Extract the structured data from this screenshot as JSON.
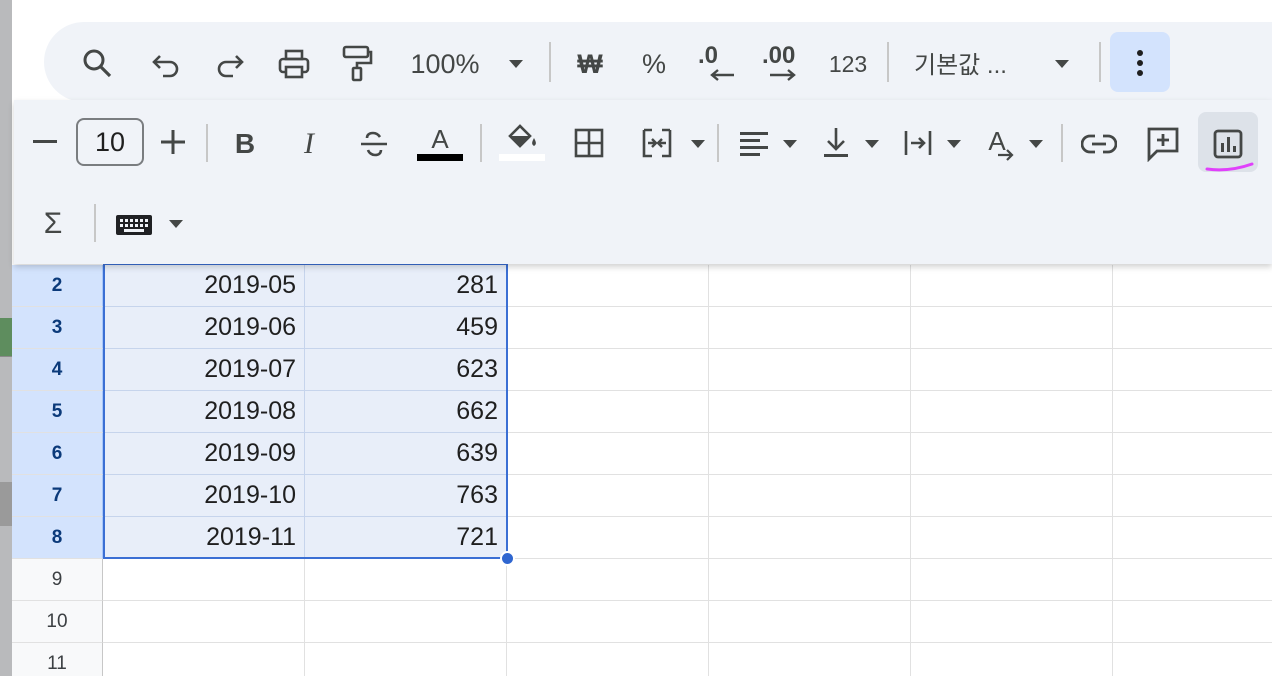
{
  "toolbar": {
    "zoom": "100%",
    "currency_symbol": "₩",
    "percent_symbol": "%",
    "decrease_decimals": ".0",
    "increase_decimals": ".00",
    "number_format": "123",
    "font_name": "기본값 ..."
  },
  "format_panel": {
    "font_size": "10",
    "bold": "B",
    "italic": "I",
    "text_color_letter": "A",
    "rotate_letter": "A",
    "sum_symbol": "Σ"
  },
  "rows": [
    {
      "num": "2",
      "date": "2019-05",
      "value": "281"
    },
    {
      "num": "3",
      "date": "2019-06",
      "value": "459"
    },
    {
      "num": "4",
      "date": "2019-07",
      "value": "623"
    },
    {
      "num": "5",
      "date": "2019-08",
      "value": "662"
    },
    {
      "num": "6",
      "date": "2019-09",
      "value": "639"
    },
    {
      "num": "7",
      "date": "2019-10",
      "value": "763"
    },
    {
      "num": "8",
      "date": "2019-11",
      "value": "721"
    }
  ],
  "empty_rows": [
    "9",
    "10",
    "11"
  ],
  "colors": {
    "accent": "#2f66d0",
    "selection_fill": "#e8eef9",
    "selected_header": "#d3e3fd",
    "pen_mark": "#e040fb"
  }
}
